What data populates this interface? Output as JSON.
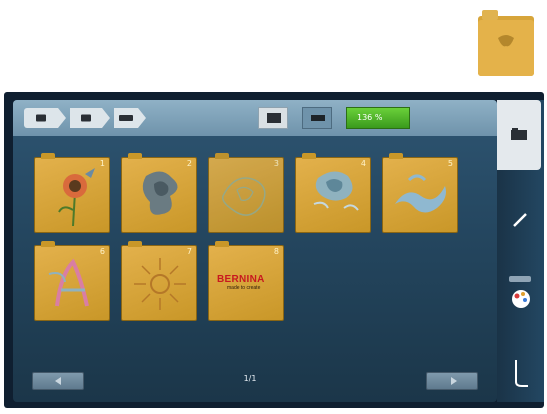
{
  "top_folder": {
    "icon": "folder-icon"
  },
  "breadcrumb": {
    "items": [
      {
        "icon": "usb-icon"
      },
      {
        "icon": "folder-icon"
      },
      {
        "icon": "embroidery-icon"
      }
    ]
  },
  "toolbar": {
    "view_icon_a": "thumbnail-view-icon",
    "view_icon_b": "list-view-icon",
    "zoom_label": "136 %"
  },
  "tiles": [
    {
      "num": "1",
      "motif": "flower",
      "icon": "flower-design-icon"
    },
    {
      "num": "2",
      "motif": "rose",
      "icon": "rose-design-icon"
    },
    {
      "num": "3",
      "motif": "lace",
      "icon": "lace-design-icon"
    },
    {
      "num": "4",
      "motif": "rose-lace",
      "icon": "rose-lace-design-icon"
    },
    {
      "num": "5",
      "motif": "swirl",
      "icon": "swirl-design-icon"
    },
    {
      "num": "6",
      "motif": "letter",
      "icon": "letter-design-icon"
    },
    {
      "num": "7",
      "motif": "sun",
      "icon": "sun-design-icon"
    },
    {
      "num": "8",
      "motif": "logo",
      "icon": "bernina-logo-icon",
      "logo_text": "BERNINA",
      "logo_sub": "made to create"
    }
  ],
  "pager": {
    "label": "1/1"
  },
  "sidebar": {
    "items": [
      {
        "icon": "folder-icon",
        "label": ""
      },
      {
        "icon": "edit-pencil-icon",
        "label": ""
      },
      {
        "icon": "color-palette-icon",
        "label": ""
      },
      {
        "icon": "needle-icon",
        "label": ""
      }
    ]
  },
  "colors": {
    "accent": "#c99728",
    "screen_bg": "#24465f",
    "zoom_green": "#4bb024"
  }
}
